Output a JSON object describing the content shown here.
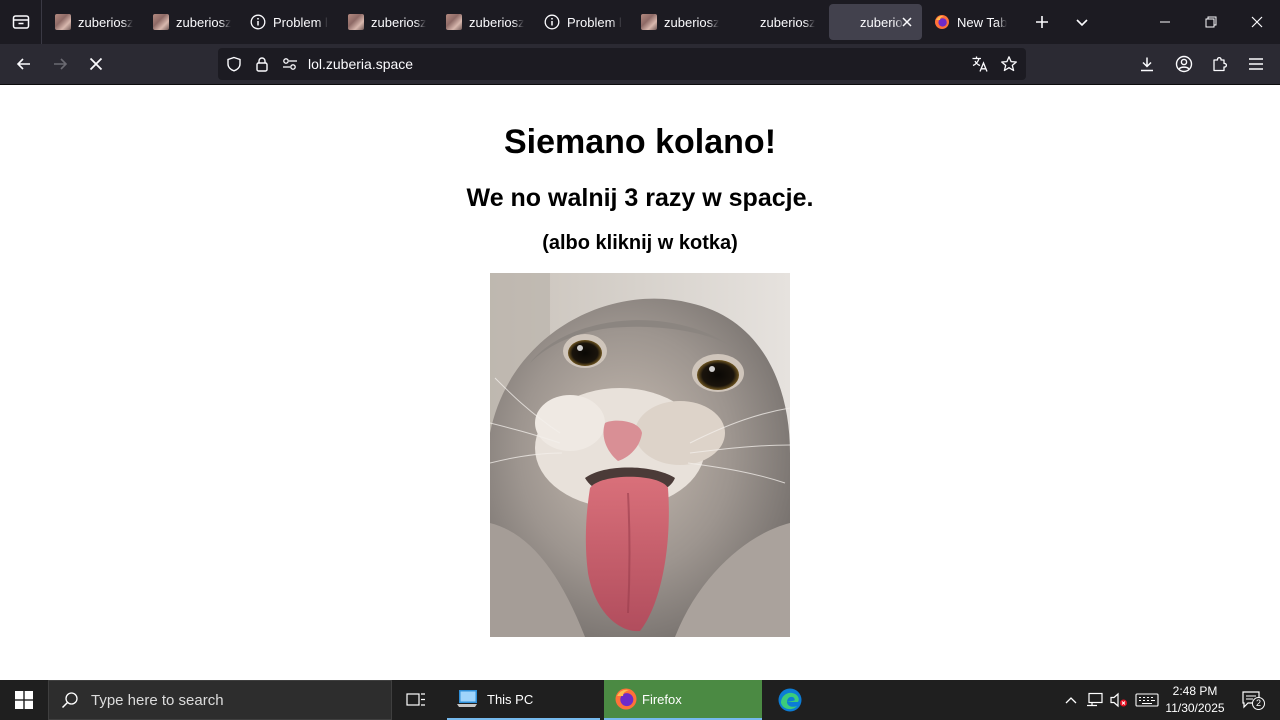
{
  "browser": {
    "tabs": [
      {
        "label": "zuberiosze",
        "favicon": "image"
      },
      {
        "label": "zuberiosze",
        "favicon": "image"
      },
      {
        "label": "Problem lo",
        "favicon": "info-icon"
      },
      {
        "label": "zuberiosze",
        "favicon": "image"
      },
      {
        "label": "zuberiosze",
        "favicon": "image"
      },
      {
        "label": "Problem lo",
        "favicon": "info-icon"
      },
      {
        "label": "zuberiosze",
        "favicon": "image"
      },
      {
        "label": "zuberiosze",
        "favicon": "none"
      },
      {
        "label": "zuberio",
        "favicon": "none",
        "active": true
      },
      {
        "label": "New Tab",
        "favicon": "firefox-icon"
      }
    ],
    "url": "lol.zuberia.space",
    "accent": "#42414d"
  },
  "page": {
    "heading": "Siemano kolano!",
    "subheading": "We no walnij 3 razy w spacje.",
    "hint": "(albo kliknij w kotka)"
  },
  "taskbar": {
    "search_placeholder": "Type here to search",
    "apps": [
      {
        "label": "This PC",
        "icon": "file-explorer-icon"
      },
      {
        "label": "Firefox",
        "icon": "firefox-icon",
        "active": true
      },
      {
        "label": "",
        "icon": "edge-icon"
      }
    ],
    "time": "2:48 PM",
    "date": "11/30/2025",
    "notifications": "2"
  }
}
